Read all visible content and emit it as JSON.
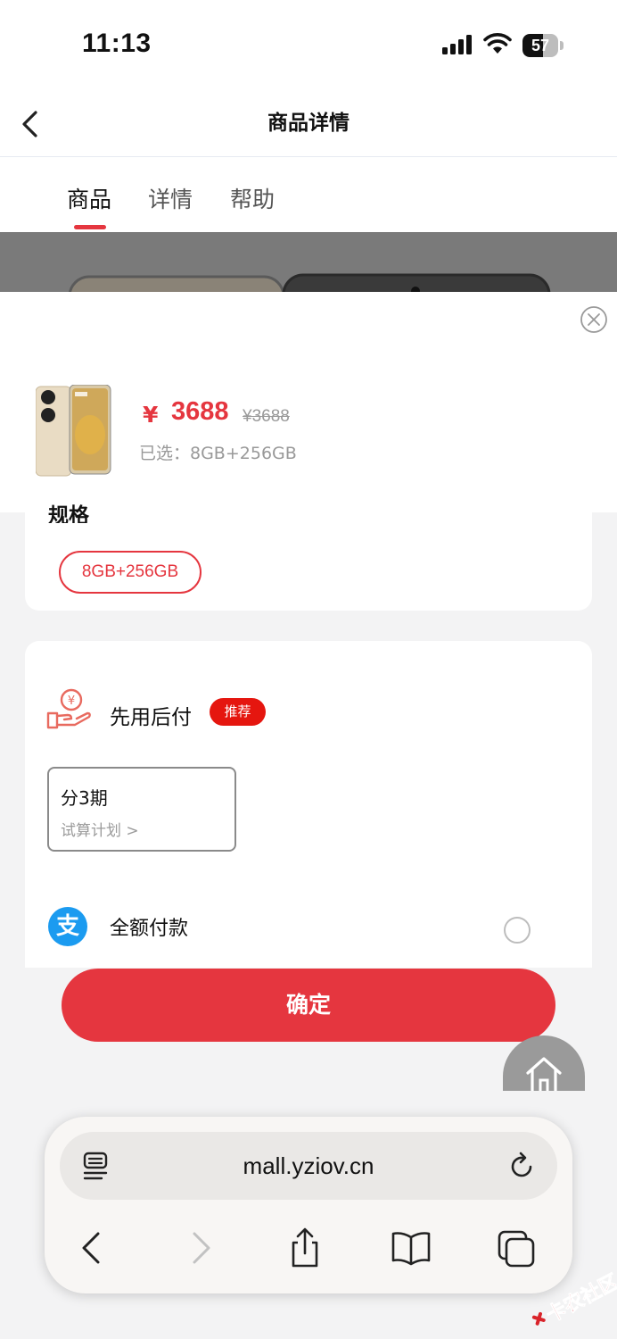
{
  "status_bar": {
    "time": "11:13",
    "battery": "57"
  },
  "nav": {
    "title": "商品详情"
  },
  "tabs": [
    {
      "label": "商品",
      "active": true
    },
    {
      "label": "详情",
      "active": false
    },
    {
      "label": "帮助",
      "active": false
    }
  ],
  "sku": {
    "currency_symbol": "¥",
    "price": "3688",
    "original_price": "¥3688",
    "selected_text": "已选：8GB+256GB"
  },
  "spec": {
    "title": "规格",
    "options": [
      "8GB+256GB"
    ]
  },
  "payment": {
    "bnpl_label": "先用后付",
    "bnpl_badge": "推荐",
    "installment_title": "分3期",
    "installment_sub": "试算计划 >",
    "full_label": "全额付款"
  },
  "confirm_label": "确定",
  "browser": {
    "url": "mall.yziov.cn"
  },
  "watermark_text": "卡农社区",
  "colors": {
    "accent": "#e5363f",
    "alipay": "#1b9bf0"
  }
}
